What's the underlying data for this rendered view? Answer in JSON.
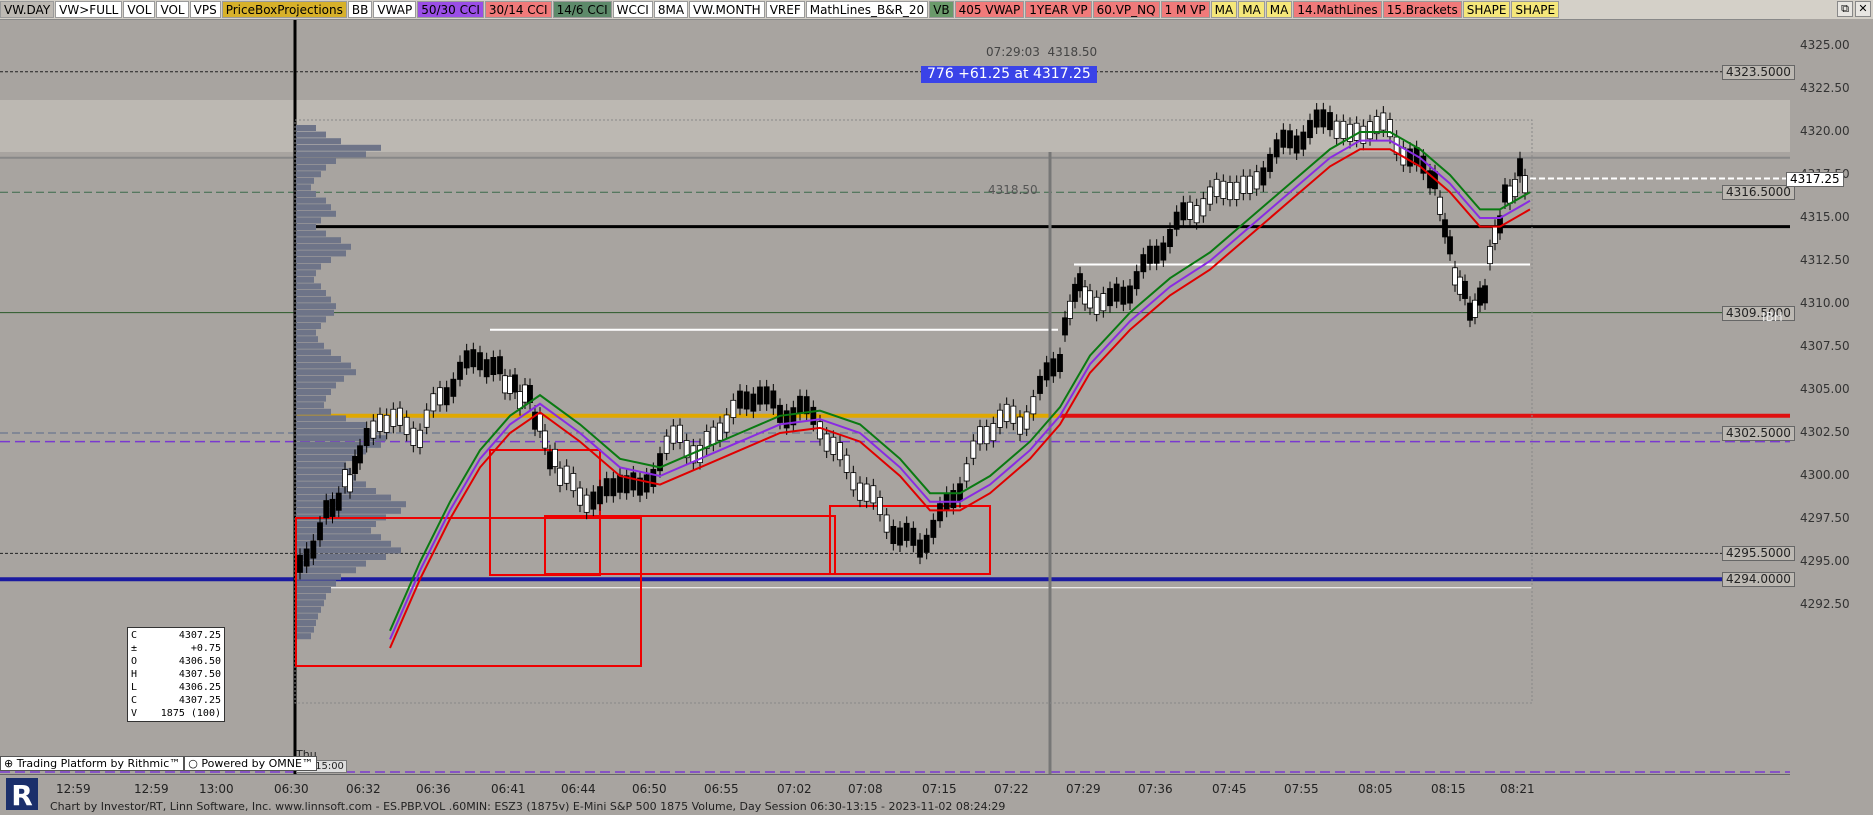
{
  "toolbar": {
    "buttons": [
      {
        "label": "VW.DAY",
        "color": "#bdb9b3"
      },
      {
        "label": "VW>FULL",
        "color": "#ffffff"
      },
      {
        "label": "VOL",
        "color": "#ffffff"
      },
      {
        "label": "VOL",
        "color": "#ffffff"
      },
      {
        "label": "VPS",
        "color": "#ffffff"
      },
      {
        "label": "PriceBoxProjections",
        "color": "#d7b12a"
      },
      {
        "label": "BB",
        "color": "#ffffff"
      },
      {
        "label": "VWAP",
        "color": "#ffffff"
      },
      {
        "label": "50/30 CCI",
        "color": "#9a4ee6"
      },
      {
        "label": "30/14 CCI",
        "color": "#f07a7a"
      },
      {
        "label": "14/6 CCI",
        "color": "#5d8a6a"
      },
      {
        "label": "WCCI",
        "color": "#ffffff"
      },
      {
        "label": "8MA",
        "color": "#ffffff"
      },
      {
        "label": "VW.MONTH",
        "color": "#ffffff"
      },
      {
        "label": "VREF",
        "color": "#ffffff"
      },
      {
        "label": "MathLines_B&R_20",
        "color": "#ffffff"
      },
      {
        "label": "VB",
        "color": "#6a9a6a"
      },
      {
        "label": "405 VWAP",
        "color": "#f07a7a"
      },
      {
        "label": "1YEAR VP",
        "color": "#f07a7a"
      },
      {
        "label": "60.VP_NQ",
        "color": "#f07a7a"
      },
      {
        "label": "1 M VP",
        "color": "#f07a7a"
      },
      {
        "label": "MA",
        "color": "#f5e77a"
      },
      {
        "label": "MA",
        "color": "#f5e77a"
      },
      {
        "label": "MA",
        "color": "#f5e77a"
      },
      {
        "label": "14.MathLines",
        "color": "#f07a7a"
      },
      {
        "label": "15.Brackets",
        "color": "#f07a7a"
      },
      {
        "label": "SHAPE",
        "color": "#f5e77a"
      },
      {
        "label": "SHAPE",
        "color": "#f5e77a"
      }
    ],
    "window_buttons": [
      "⧉",
      "✕"
    ]
  },
  "price_axis": {
    "ticks": [
      "4325.00",
      "4322.50",
      "4320.00",
      "4317.50",
      "4315.00",
      "4312.50",
      "4310.00",
      "4307.50",
      "4305.00",
      "4302.50",
      "4300.00",
      "4297.50",
      "4295.00",
      "4292.50"
    ],
    "boxed_levels": [
      "4323.5000",
      "4316.5000",
      "4309.5000",
      "4302.5000",
      "4295.5000",
      "4294.0000"
    ],
    "current_price": "4317.25"
  },
  "time_axis": {
    "labels": [
      "12:59",
      "12:59",
      "13:00",
      "06:30",
      "06:32",
      "06:36",
      "06:41",
      "06:44",
      "06:50",
      "06:55",
      "07:02",
      "07:08",
      "07:15",
      "07:22",
      "07:29",
      "07:36",
      "07:45",
      "07:55",
      "08:05",
      "08:15",
      "08:21"
    ]
  },
  "overlay": {
    "clock": "07:29:03",
    "clock_price": "4318.50",
    "tag": "776  +61.25 at 4317.25",
    "poc_label": "4318.50",
    "ibh_label": "IBH",
    "thu_label": "Thu",
    "thu_time": "13:15:00"
  },
  "ohlc_box": {
    "rows": [
      {
        "k": "C",
        "v": "4307.25"
      },
      {
        "k": "±",
        "v": "+0.75"
      },
      {
        "k": "O",
        "v": "4306.50"
      },
      {
        "k": "H",
        "v": "4307.50"
      },
      {
        "k": "L",
        "v": "4306.25"
      },
      {
        "k": "C",
        "v": "4307.25"
      },
      {
        "k": "V",
        "v": "1875 (100)"
      }
    ]
  },
  "attribution": {
    "rithmic": "Trading Platform by Rithmic™",
    "omne": "Powered by OMNE™"
  },
  "footer": {
    "text": "Chart by Investor/RT, Linn Software, Inc. www.linnsoft.com - ES.PBP.VOL .60MIN: ESZ3 (1875v) E-Mini S&P 500 1875 Volume, Day Session 06:30-13:15 - 2023-11-02 08:24:29"
  },
  "colors": {
    "background": "#a8a4a0",
    "vwap_green": "#0a7a12",
    "vwap_purple": "#8a2be2",
    "vwap_red": "#e00000",
    "gold_line": "#e0a800",
    "blue_line": "#1a1aa0",
    "tag_blue": "#3a43e8"
  }
}
